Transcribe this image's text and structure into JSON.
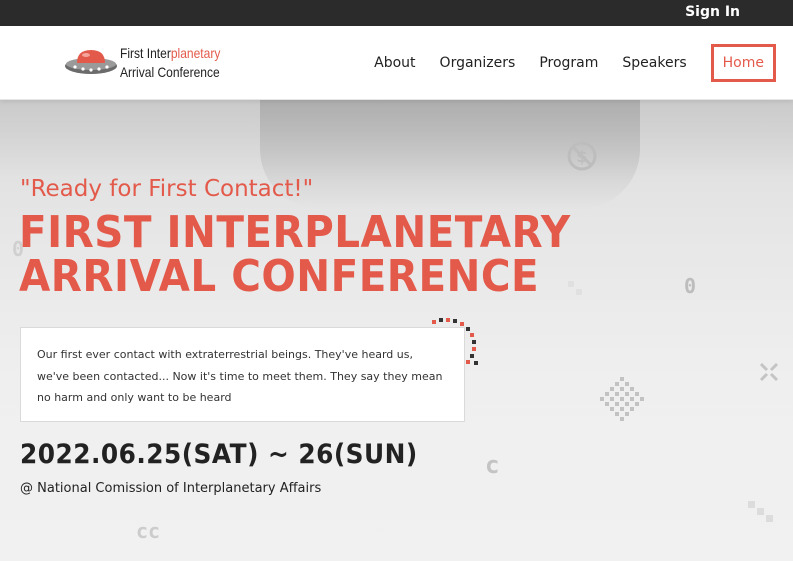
{
  "topbar": {
    "sign_in_label": "Sign In"
  },
  "logo": {
    "line1_black": "First Inter",
    "line1_red": "planetary",
    "line2": "Arrival Conference"
  },
  "nav": {
    "items": [
      {
        "label": "About"
      },
      {
        "label": "Organizers"
      },
      {
        "label": "Program"
      },
      {
        "label": "Speakers"
      },
      {
        "label": "Home",
        "active": true
      }
    ]
  },
  "hero": {
    "tagline": "\"Ready for First Contact!\"",
    "title_line1": "FIRST INTERPLANETARY",
    "title_line2": "ARRIVAL CONFERENCE",
    "description": "Our first ever contact with extraterrestrial beings. They've heard us, we've been contacted... Now it's time to meet them. They say they mean no harm and only want to be heard",
    "date": "2022.06.25(SAT) ~ 26(SUN)",
    "venue": "@ National Comission of Interplanetary Affairs"
  },
  "colors": {
    "accent": "#e35a4b",
    "dark": "#222222",
    "topbar": "#2b2b2b"
  },
  "icons": [
    "ufo-logo-icon",
    "no-dollar-icon",
    "close-cross-icon",
    "diamond-dots-icon"
  ]
}
